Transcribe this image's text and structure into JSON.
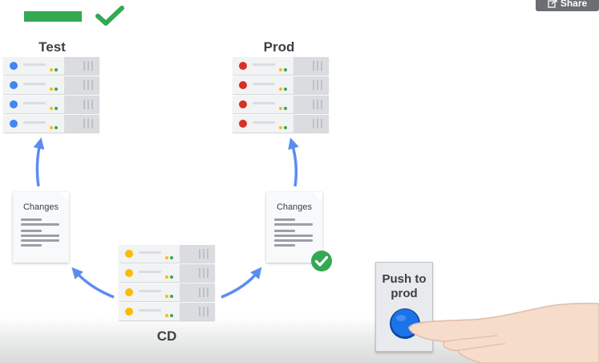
{
  "header": {
    "share_label": "Share"
  },
  "environments": {
    "test": {
      "label": "Test",
      "status_color": "#4285f4"
    },
    "prod": {
      "label": "Prod",
      "status_color": "#d93025"
    },
    "cd": {
      "label": "CD",
      "status_color": "#fbbc04"
    }
  },
  "documents": {
    "left": {
      "title": "Changes"
    },
    "right": {
      "title": "Changes"
    }
  },
  "push_button": {
    "label_line1": "Push to",
    "label_line2": "prod"
  },
  "colors": {
    "arrow": "#5b8def",
    "check": "#34a853",
    "progress": "#34a853",
    "button": "#1a73e8"
  }
}
